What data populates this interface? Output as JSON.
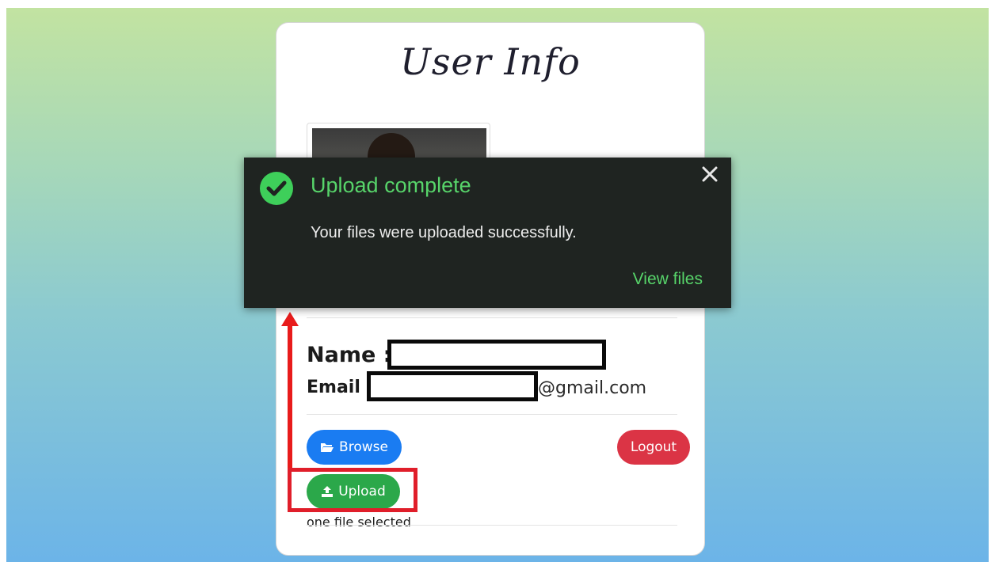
{
  "card": {
    "title": "User Info",
    "name_label": "Name :",
    "email_label": "Email :",
    "email_domain": "@gmail.com",
    "browse_label": "Browse",
    "logout_label": "Logout",
    "upload_label": "Upload",
    "file_status": "one file selected"
  },
  "toast": {
    "title": "Upload complete",
    "message": "Your files were uploaded successfully.",
    "link_label": "View files"
  },
  "colors": {
    "primary": "#1a7cf2",
    "danger": "#db3445",
    "success": "#2ba84a",
    "toast_accent": "#57d46a",
    "annotation": "#e01e2a"
  },
  "icons": {
    "toast_status": "check-circle-icon",
    "toast_close": "close-icon",
    "browse": "folder-open-icon",
    "upload": "upload-icon"
  }
}
